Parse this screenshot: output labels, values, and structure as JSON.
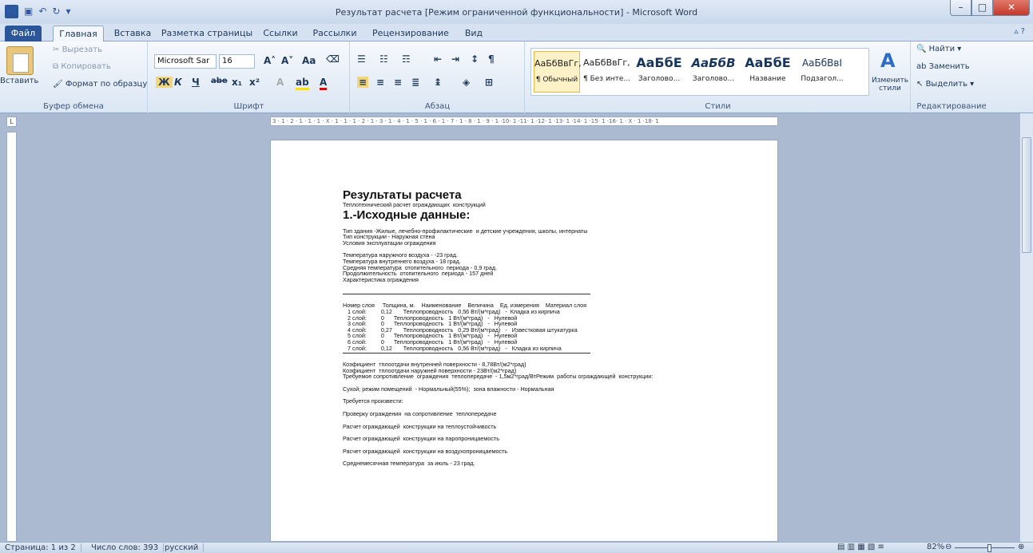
{
  "window": {
    "title": "Результат расчета [Режим ограниченной функциональности] - Microsoft Word",
    "app_icon": "W"
  },
  "tabs": [
    "Файл",
    "Главная",
    "Вставка",
    "Разметка страницы",
    "Ссылки",
    "Рассылки",
    "Рецензирование",
    "Вид"
  ],
  "clipboard": {
    "paste": "Вставить",
    "cut": "Вырезать",
    "copy": "Копировать",
    "format": "Формат по образцу",
    "label": "Буфер обмена"
  },
  "font": {
    "family": "Microsoft Sar",
    "size": "16",
    "label": "Шрифт",
    "bold": "Ж",
    "italic": "К",
    "underline": "Ч",
    "strike": "abe",
    "sub": "x₁",
    "sup": "x²"
  },
  "paragraph": {
    "label": "Абзац"
  },
  "styles": {
    "label": "Стили",
    "items": [
      {
        "preview": "АаБбВвГг,",
        "name": "¶ Обычный"
      },
      {
        "preview": "АаБбВвГг,",
        "name": "¶ Без инте..."
      },
      {
        "preview": "АаБбЕ",
        "name": "Заголово..."
      },
      {
        "preview": "АаБбВ",
        "name": "Заголово..."
      },
      {
        "preview": "АаБбЕ",
        "name": "Название"
      },
      {
        "preview": "АаБбВвІ",
        "name": "Подзагол..."
      }
    ],
    "change": "Изменить стили"
  },
  "editing": {
    "find": "Найти",
    "replace": "Заменить",
    "select": "Выделить",
    "label": "Редактирование"
  },
  "ruler": {
    "corner": "L",
    "marks": "3 · 1 · 2 · 1 · 1 · 1 · X · 1 · 1 · 1 · 2 · 1 · 3 · 1 · 4 · 1 · 5 · 1 · 6 · 1 · 7 · 1 · 8 · 1 · 9 · 1 ·10· 1 ·11· 1 ·12· 1 ·13· 1 ·14· 1 ·15· 1 ·16· 1 · X · 1 ·18· 1"
  },
  "doc": {
    "title": "Результаты расчета",
    "subtitle": "Теплотехнический расчет ограждающих  конструкций",
    "h2": "1.-Исходные данные:",
    "block1": [
      "Тип здания -Жилые, лечебно-профилактические  и детские учреждения, школы, интернаты",
      "Тип конструкции - Наружная стена",
      "Условия эксплуатации ограждения"
    ],
    "block2": [
      "Температура наружного воздуха - -23 град.",
      "Температура внутреннего воздуха - 18 град.",
      "Средняя температура  отопительного  периода - 0,9 град.",
      "Продолжительность  отопительного  периода - 157 дней",
      "Характеристика ограждения"
    ],
    "table": [
      "Номер слоя     Толщина, м.    Наименование    Величина    Ед. измерения    Материал слоя",
      "   1 слой:         0,12       Теплопроводность   0,56 Вт/(м*град)   -  Кладка из кирпича",
      "   2 слой:         0      Теплопроводность   1 Вт/(м*град)   -   Нулевой",
      "   3 слой:         0      Теплопроводность   1 Вт/(м*град)   -   Нулевой",
      "   4 слой:         0,27       Теплопроводность   0,29 Вт/(м*град)   -   Известковая штукатурка",
      "   5 слой:         0      Теплопроводность   1 Вт/(м*град)   -   Нулевой",
      "   6 слой:         0      Теплопроводность   1 Вт/(м*град)   -   Нулевой",
      "   7 слой:         0,12       Теплопроводность   0,56 Вт/(м*град)   -   Кладка из кирпича"
    ],
    "block3": [
      "Коэфициент  тплоотдачи внутренней поверхности - 8,78Вт/(м2*град)",
      "Коэфициент  тплоотдачи наружней поверхности - 23Вт/(м2*град)",
      "Требуемое сопротивление  ограждения  теплопередаче  - 1,5м2*град/ВтРежим  работы ограждающей  конструкции:"
    ],
    "humidity": "Сухой; режим помещений  - Нормальный(55%);  зона влажности - Нормальная",
    "required": "Требуется произвести:",
    "tasks": [
      "Проверку ограждения  на сопротивление  теплопередаче",
      "Расчет ограждающей  конструкции на теплоустойчивость",
      "Расчет ограждающей  конструкции на паропроницаемость",
      "Расчет ограждающей  конструкции на воздухопроницаемость"
    ],
    "last": "Среднемесячная температура  за июль - 23 град."
  },
  "status": {
    "page": "Страница: 1 из 2",
    "words": "Число слов: 393",
    "lang": "русский",
    "zoom": "82%"
  }
}
